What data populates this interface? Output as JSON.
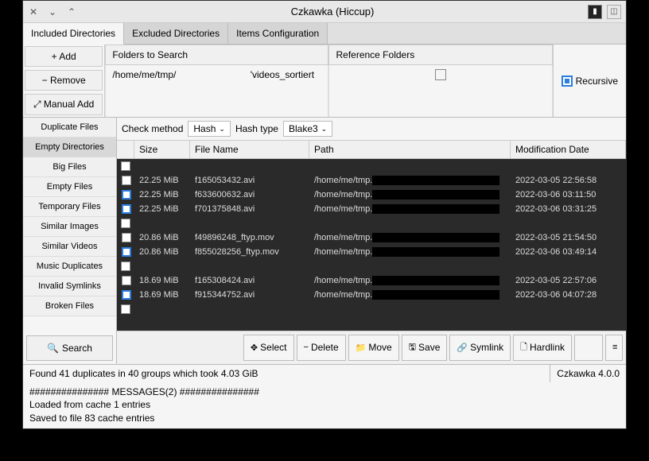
{
  "title": "Czkawka (Hiccup)",
  "tabs": {
    "included": "Included Directories",
    "excluded": "Excluded Directories",
    "items": "Items Configuration"
  },
  "folderBtns": {
    "add": "+  Add",
    "remove": "−  Remove",
    "manual": "⤢  Manual Add"
  },
  "folderHeaders": {
    "search": "Folders to Search",
    "ref": "Reference Folders"
  },
  "folders": {
    "path1": "/home/me/tmp/",
    "path2": "'videos_sortiert"
  },
  "recursive": "Recursive",
  "sidebar": [
    "Duplicate Files",
    "Empty Directories",
    "Big Files",
    "Empty Files",
    "Temporary Files",
    "Similar Images",
    "Similar Videos",
    "Music Duplicates",
    "Invalid Symlinks",
    "Broken Files"
  ],
  "searchBtn": "Search",
  "check": {
    "method_lbl": "Check method",
    "method": "Hash",
    "hashtype_lbl": "Hash type",
    "hashtype": "Blake3"
  },
  "cols": {
    "size": "Size",
    "name": "File Name",
    "path": "Path",
    "date": "Modification Date"
  },
  "rows": [
    {
      "sep": true
    },
    {
      "size": "22.25 MiB",
      "name": "f165053432.avi",
      "path": "/home/me/tmp.",
      "date": "2022-03-05 22:56:58",
      "blue": false
    },
    {
      "size": "22.25 MiB",
      "name": "f633600632.avi",
      "path": "/home/me/tmp.",
      "date": "2022-03-06 03:11:50",
      "blue": true
    },
    {
      "size": "22.25 MiB",
      "name": "f701375848.avi",
      "path": "/home/me/tmp.",
      "date": "2022-03-06 03:31:25",
      "blue": true
    },
    {
      "sep": true
    },
    {
      "size": "20.86 MiB",
      "name": "f49896248_ftyp.mov",
      "path": "/home/me/tmp.",
      "date": "2022-03-05 21:54:50",
      "blue": false
    },
    {
      "size": "20.86 MiB",
      "name": "f855028256_ftyp.mov",
      "path": "/home/me/tmp.",
      "date": "2022-03-06 03:49:14",
      "blue": true
    },
    {
      "sep": true
    },
    {
      "size": "18.69 MiB",
      "name": "f165308424.avi",
      "path": "/home/me/tmp.",
      "date": "2022-03-05 22:57:06",
      "blue": false
    },
    {
      "size": "18.69 MiB",
      "name": "f915344752.avi",
      "path": "/home/me/tmp.",
      "date": "2022-03-06 04:07:28",
      "blue": true
    },
    {
      "sep": true
    }
  ],
  "actions": {
    "select": "Select",
    "delete": "Delete",
    "move": "Move",
    "save": "Save",
    "symlink": "Symlink",
    "hardlink": "Hardlink"
  },
  "status": {
    "left": "Found 41 duplicates in 40 groups which took 4.03 GiB",
    "right": "Czkawka 4.0.0"
  },
  "messages": [
    "############### MESSAGES(2) ###############",
    "Loaded from cache 1 entries",
    "Saved to file 83 cache entries"
  ]
}
